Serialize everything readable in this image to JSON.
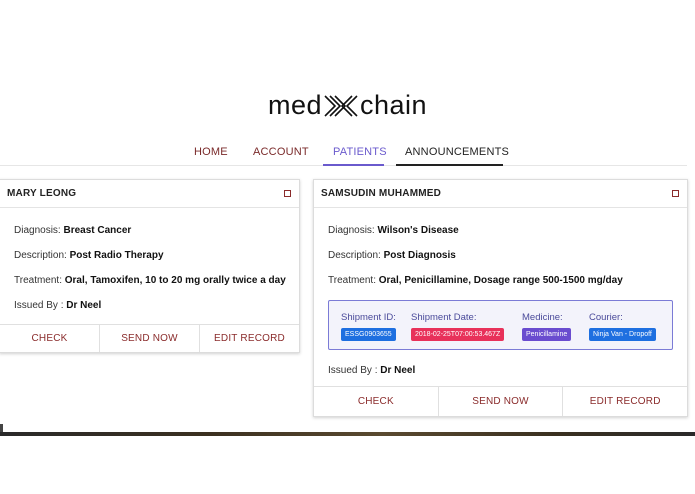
{
  "brand": {
    "name_left": "med",
    "name_right": "chain"
  },
  "nav": {
    "items": [
      {
        "label": "HOME"
      },
      {
        "label": "ACCOUNT"
      },
      {
        "label": "PATIENTS"
      },
      {
        "label": "ANNOUNCEMENTS"
      }
    ],
    "active_label": "PATIENTS",
    "colors": {
      "default": "#7a2a2a",
      "active": "#6a5acd"
    }
  },
  "cards": [
    {
      "name": "MARY LEONG",
      "diagnosis_label": "Diagnosis:",
      "diagnosis": "Breast Cancer",
      "description_label": "Description:",
      "description": "Post Radio Therapy",
      "treatment_label": "Treatment:",
      "treatment": "Oral, Tamoxifen, 10 to 20 mg orally twice a day",
      "issued_label": "Issued By :",
      "issued_by": "Dr Neel",
      "actions": [
        "CHECK",
        "SEND NOW",
        "EDIT RECORD"
      ]
    },
    {
      "name": "SAMSUDIN MUHAMMED",
      "diagnosis_label": "Diagnosis:",
      "diagnosis": "Wilson's Disease",
      "description_label": "Description:",
      "description": "Post Diagnosis",
      "treatment_label": "Treatment:",
      "treatment": "Oral, Penicillamine, Dosage range 500-1500 mg/day",
      "shipment": {
        "id_label": "Shipment ID:",
        "id": "ESSG0903655",
        "date_label": "Shipment Date:",
        "date": "2018-02-25T07:00:53.467Z",
        "medicine_label": "Medicine:",
        "medicine": "Penicillamine",
        "courier_label": "Courier:",
        "courier": "Ninja Van - Dropoff",
        "badge_colors": {
          "id": "#1e6fe0",
          "date": "#e8315a",
          "medicine": "#6a4ccf",
          "courier": "#1e6fe0"
        }
      },
      "issued_label": "Issued By :",
      "issued_by": "Dr Neel",
      "actions": [
        "CHECK",
        "SEND NOW",
        "EDIT RECORD"
      ]
    }
  ],
  "accent_color": "#8a2b2b"
}
